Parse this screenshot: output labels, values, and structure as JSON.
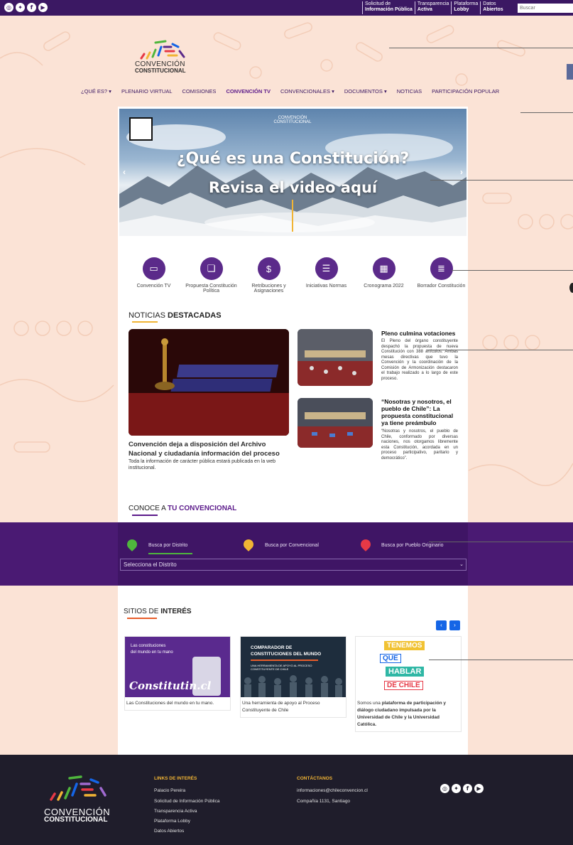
{
  "topbar": {
    "social": [
      "instagram-icon",
      "twitter-icon",
      "facebook-icon",
      "youtube-icon"
    ],
    "links": [
      {
        "line1": "Solicitud de",
        "line2": "Información Pública"
      },
      {
        "line1": "Transparencia",
        "line2": "Activa"
      },
      {
        "line1": "Plataforma",
        "line2": "Lobby"
      },
      {
        "line1": "Datos",
        "line2": "Abiertos"
      }
    ],
    "search_placeholder": "Buscar"
  },
  "logo": {
    "line1": "CONVENCIÓN",
    "line2": "CONSTITUCIONAL"
  },
  "nav": [
    "¿QUÉ ES? ▾",
    "PLENARIO VIRTUAL",
    "COMISIONES",
    "CONVENCIÓN TV",
    "CONVENCIONALES ▾",
    "DOCUMENTOS ▾",
    "NOTICIAS",
    "PARTICIPACIÓN POPULAR"
  ],
  "hero": {
    "title": "¿Qué es una Constitución?",
    "subtitle": "Revisa el video aquí",
    "logo_line1": "CONVENCIÓN",
    "logo_line2": "CONSTITUCIONAL",
    "prev": "‹",
    "next": "›"
  },
  "quick_links": [
    {
      "label": "Convención TV",
      "icon": "tv-icon"
    },
    {
      "label": "Propuesta Constitución Política",
      "icon": "book-icon"
    },
    {
      "label": "Retribuciones y Asignaciones",
      "icon": "dollar-icon"
    },
    {
      "label": "Iniciativas Normas",
      "icon": "document-icon"
    },
    {
      "label": "Cronograma 2022",
      "icon": "calendar-icon"
    },
    {
      "label": "Borrador Constitución",
      "icon": "draft-icon"
    }
  ],
  "news": {
    "heading_plain": "NOTICIAS",
    "heading_bold": "DESTACADAS",
    "main_title": "Convención deja a disposición del Archivo Nacional y ciudadanía información del proceso",
    "main_desc": "Toda la información de carácter pública estará publicada en la web institucional.",
    "side1_title": "Pleno culmina votaciones",
    "side1_desc": "El Pleno del órgano constituyente despachó la propuesta de nueva Constitución con 388 artículos. Ambas mesas directivas que tuvo la Convención y la coordinación de la Comisión de Armonización destacaron el trabajo realizado a lo largo de este proceso.",
    "side2_title": "“Nosotras y nosotros, el pueblo de Chile”: La propuesta constitucional ya tiene preámbulo",
    "side2_desc": "“Nosotras y nosotros, el pueblo de Chile, conformado por diversas naciones, nos otorgamos libremente esta Constitución, acordada en un proceso participativo, paritario y democrático”."
  },
  "conoce": {
    "heading_plain": "CONOCE A",
    "heading_bold": "TU CONVENCIONAL",
    "tabs": [
      "Busca por Distrito",
      "Busca por Convencional",
      "Busca por Pueblo Originario"
    ],
    "select_value": "Selecciona el Distrito"
  },
  "interest": {
    "heading_plain": "SITIOS DE",
    "heading_bold": "INTERÉS",
    "cards": [
      {
        "img_line1": "Las constituciones",
        "img_line2": "del mundo en tu mano",
        "img_brand": "Constitutin.cl",
        "desc": "Las Constituciones del mundo en tu mano."
      },
      {
        "img_line1": "COMPARADOR DE",
        "img_line2": "CONSTITUCIONES DEL MUNDO",
        "img_sub": "UNA HERRAMIENTA DE APOYO AL PROCESO CONSTITUYENTE DE CHILE",
        "desc": "Una herramienta de apoyo al Proceso Constituyente de Chile"
      },
      {
        "img_words": [
          "TENEMOS",
          "QUE",
          "HABLAR",
          "DE CHILE"
        ],
        "desc_pre": "Somos una ",
        "desc_bold": "plataforma de participación y diálogo ciudadano impulsada por la Universidad de Chile y la Universidad Católica."
      }
    ],
    "prev": "‹",
    "next": "›"
  },
  "footer": {
    "logo_line1": "CONVENCIÓN",
    "logo_line2": "CONSTITUCIONAL",
    "links_head": "LINKS DE INTERÉS",
    "links": [
      "Palacio Pereira",
      "Solicitud de Información Pública",
      "Transparencia Activa",
      "Plataforma Lobby",
      "Datos Abiertos"
    ],
    "contact_head": "CONTÁCTANOS",
    "email": "informaciones@chileconvencion.cl",
    "address": "Compañía 1131, Santiago"
  },
  "colors": {
    "purple": "#3b1863",
    "accent_orange": "#f1b434",
    "blue_btn": "#1565e6"
  }
}
